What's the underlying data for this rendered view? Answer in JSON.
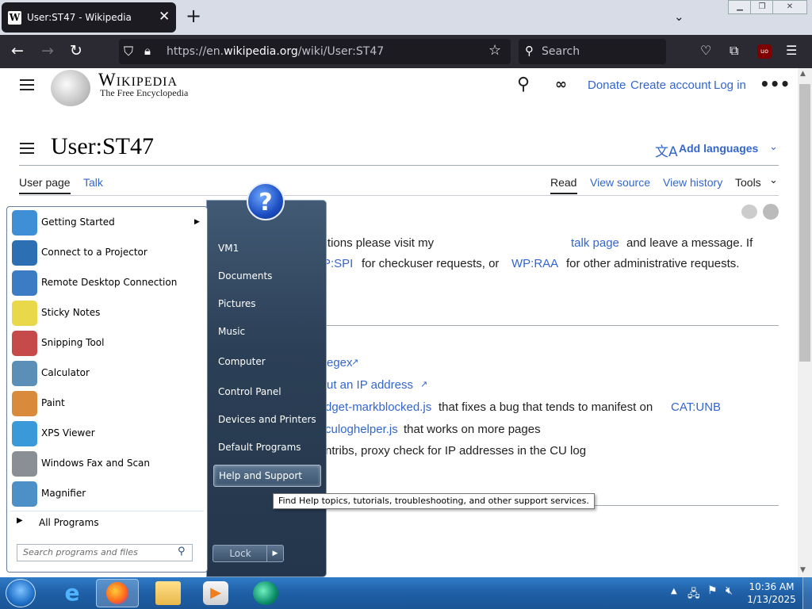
{
  "browser": {
    "tab_title": "User:ST47 - Wikipedia",
    "tab_favicon": "W",
    "url_prefix": "https://en.",
    "url_domain": "wikipedia.org",
    "url_path": "/wiki/User:ST47",
    "search_placeholder": "Search"
  },
  "wiki": {
    "wordmark": "Wikipedia",
    "tagline": "The Free Encyclopedia",
    "header_links": {
      "donate": "Donate",
      "create_account": "Create account",
      "login": "Log in"
    },
    "page_title": "User:ST47",
    "add_languages": "Add languages",
    "tabs": {
      "user_page": "User page",
      "talk": "Talk",
      "read": "Read",
      "view_source": "View source",
      "view_history": "View history",
      "tools": "Tools"
    },
    "para": {
      "p1": "ion about any of my actions please visit my",
      "talk_page": "talk page",
      "p2": "and leave a message. If",
      "wpspi": "P:SPI",
      "p3": "for checkuser requests, or",
      "wpraa": "WP:RAA",
      "p4": "for other administrative requests."
    },
    "list": {
      "l1": "egex",
      "l2": "ut an IP address",
      "l3a": "dget-markblocked.js",
      "l3b": "that fixes a bug that tends to manifest on",
      "l3c": "CAT:UNB",
      "l4a": "culoghelper.js",
      "l4b": "that works on more pages",
      "l5": "ntribs, proxy check for IP addresses in the CU log"
    }
  },
  "start_menu": {
    "programs": [
      {
        "label": "Getting Started",
        "icon": "getting-started-icon",
        "color": "#3f8fd6"
      },
      {
        "label": "Connect to a Projector",
        "icon": "projector-icon",
        "color": "#2c6fb3"
      },
      {
        "label": "Remote Desktop Connection",
        "icon": "remote-desktop-icon",
        "color": "#3b7cc4"
      },
      {
        "label": "Sticky Notes",
        "icon": "sticky-notes-icon",
        "color": "#e9d84a"
      },
      {
        "label": "Snipping Tool",
        "icon": "snipping-tool-icon",
        "color": "#c74a4a"
      },
      {
        "label": "Calculator",
        "icon": "calculator-icon",
        "color": "#5b8fb8"
      },
      {
        "label": "Paint",
        "icon": "paint-icon",
        "color": "#d98a3a"
      },
      {
        "label": "XPS Viewer",
        "icon": "xps-viewer-icon",
        "color": "#3a9ad9"
      },
      {
        "label": "Windows Fax and Scan",
        "icon": "fax-scan-icon",
        "color": "#8a8f96"
      },
      {
        "label": "Magnifier",
        "icon": "magnifier-icon",
        "color": "#4d8fc7"
      }
    ],
    "all_programs": "All Programs",
    "search_placeholder": "Search programs and files",
    "places": [
      "VM1",
      "Documents",
      "Pictures",
      "Music",
      "Computer",
      "Control Panel",
      "Devices and Printers",
      "Default Programs",
      "Help and Support"
    ],
    "lock": "Lock",
    "tooltip": "Find Help topics, tutorials, troubleshooting, and other support services."
  },
  "taskbar": {
    "time": "10:36 AM",
    "date": "1/13/2025"
  }
}
